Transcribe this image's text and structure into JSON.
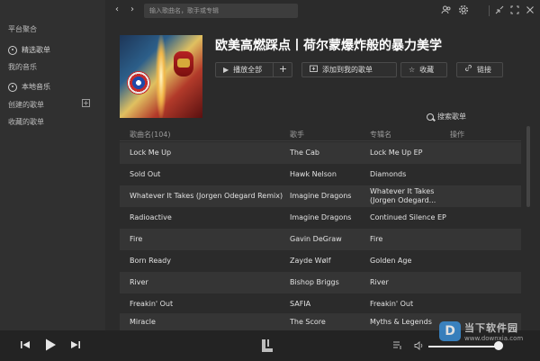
{
  "sidebar": {
    "platform_label": "平台聚合",
    "featured_label": "精选歌单",
    "my_music_label": "我的音乐",
    "local_music_label": "本地音乐",
    "created_playlists_label": "创建的歌单",
    "collected_playlists_label": "收藏的歌单"
  },
  "topbar": {
    "search_placeholder": "输入歌曲名，歌手或专辑"
  },
  "playlist": {
    "title": "欧美高燃踩点丨荷尔蒙爆炸般的暴力美学",
    "play_all_label": "播放全部",
    "add_to_my_label": "添加到我的歌单",
    "favorite_label": "收藏",
    "link_label": "链接",
    "search_songs_label": "搜索歌单"
  },
  "table": {
    "headers": {
      "song": "歌曲名(104)",
      "artist": "歌手",
      "album": "专辑名",
      "action": "操作"
    },
    "rows": [
      {
        "song": "Lock Me Up",
        "artist": "The Cab",
        "album": "Lock Me Up EP"
      },
      {
        "song": "Sold Out",
        "artist": "Hawk Nelson",
        "album": "Diamonds"
      },
      {
        "song": "Whatever It Takes (Jorgen Odegard Remix)",
        "artist": "Imagine Dragons",
        "album": "Whatever It Takes (Jorgen Odegard..."
      },
      {
        "song": "Radioactive",
        "artist": "Imagine Dragons",
        "album": "Continued Silence EP"
      },
      {
        "song": "Fire",
        "artist": "Gavin DeGraw",
        "album": "Fire"
      },
      {
        "song": "Born Ready",
        "artist": "Zayde Wølf",
        "album": "Golden Age"
      },
      {
        "song": "River",
        "artist": "Bishop Briggs",
        "album": "River"
      },
      {
        "song": "Freakin' Out",
        "artist": "SAFIA",
        "album": "Freakin' Out"
      },
      {
        "song": "Miracle",
        "artist": "The Score",
        "album": "Myths & Legends"
      }
    ]
  },
  "player": {
    "volume_level": 0.95
  },
  "watermark": {
    "badge": "D",
    "name": "当下软件园",
    "url": "www.downxia.com"
  },
  "colors": {
    "background": "#2b2b2b",
    "sidebar": "#303030",
    "player_bar": "#232323",
    "row_alt": "#353535",
    "accent_watermark": "#3b8fd6"
  }
}
